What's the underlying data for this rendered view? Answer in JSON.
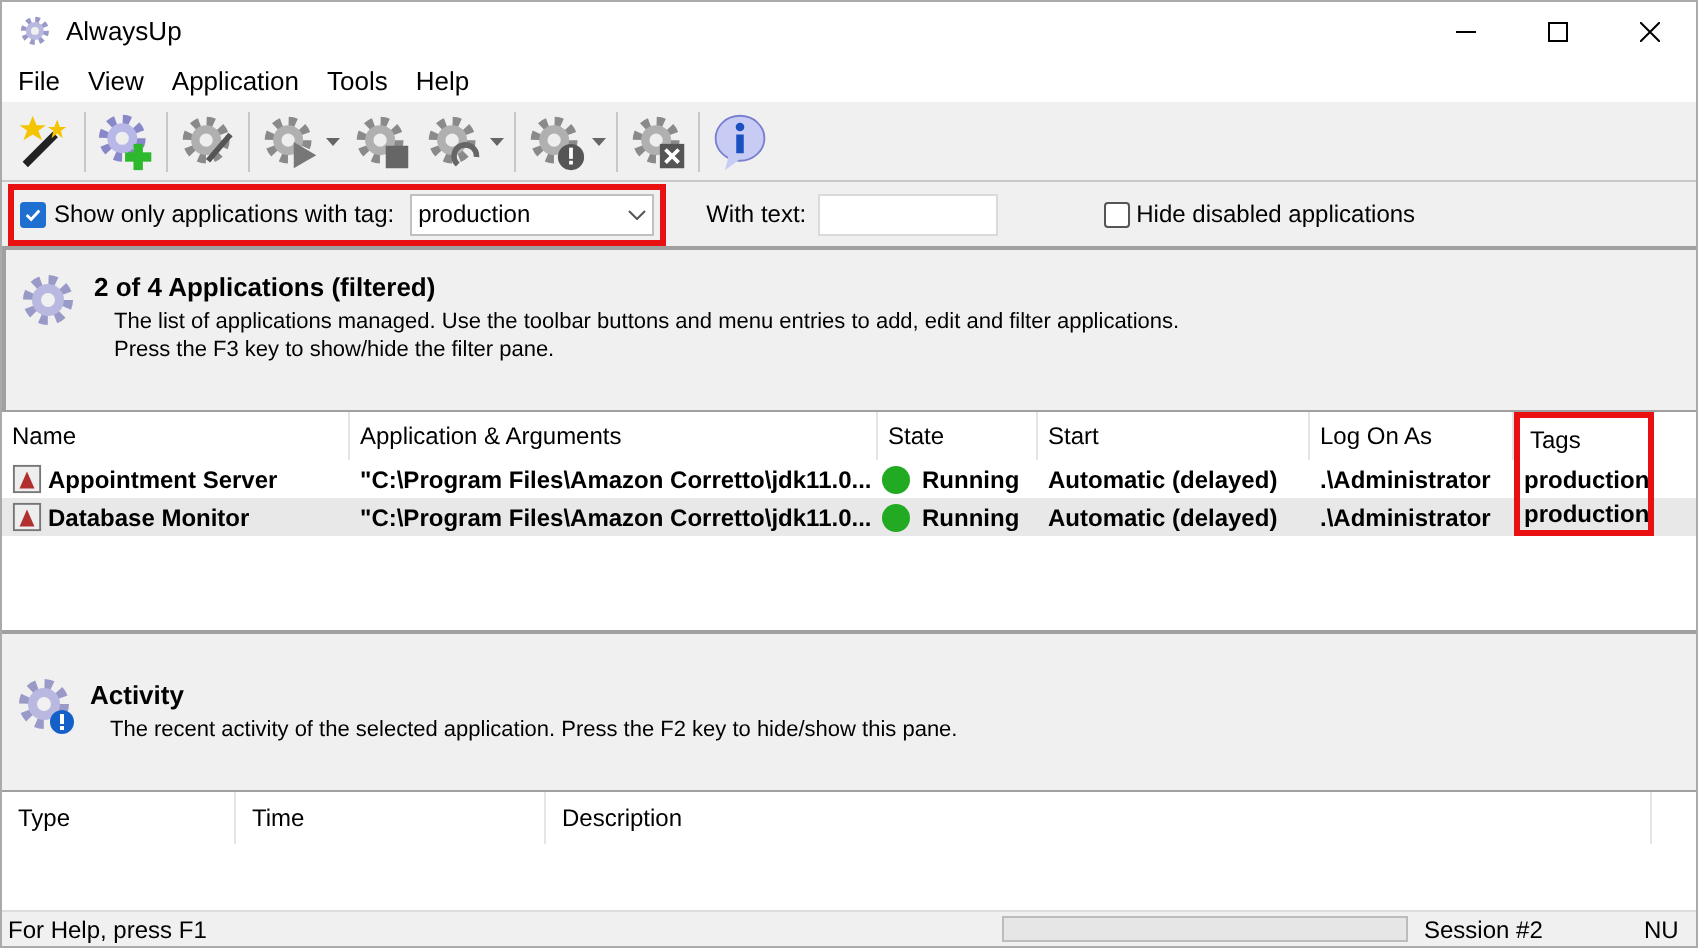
{
  "window": {
    "title": "AlwaysUp"
  },
  "menu": [
    "File",
    "View",
    "Application",
    "Tools",
    "Help"
  ],
  "toolbar": [
    {
      "kind": "wand",
      "dropdown": false
    },
    {
      "kind": "add",
      "dropdown": false
    },
    {
      "kind": "edit",
      "dropdown": false
    },
    {
      "kind": "start",
      "dropdown": true
    },
    {
      "kind": "stop",
      "dropdown": false
    },
    {
      "kind": "restart",
      "dropdown": true
    },
    {
      "kind": "alert",
      "dropdown": true
    },
    {
      "kind": "remove",
      "dropdown": false
    },
    {
      "kind": "info",
      "dropdown": false
    }
  ],
  "filter": {
    "tag_checkbox": {
      "label": "Show only applications with tag:",
      "checked": true
    },
    "tag_value": "production",
    "highlighted": true,
    "text_label": "With text:",
    "hide_disabled": {
      "label": "Hide disabled applications",
      "checked": false
    }
  },
  "apps_header": {
    "title": "2 of 4 Applications (filtered)",
    "lines": [
      "The list of applications managed. Use the toolbar buttons and menu entries to add, edit and filter applications.",
      "Press the F3 key to show/hide the filter pane."
    ]
  },
  "table": {
    "columns": [
      {
        "label": "Name",
        "highlighted": false
      },
      {
        "label": "Application & Arguments",
        "highlighted": false
      },
      {
        "label": "State",
        "highlighted": false
      },
      {
        "label": "Start",
        "highlighted": false
      },
      {
        "label": "Log On As",
        "highlighted": false
      },
      {
        "label": "Tags",
        "highlighted": true
      }
    ],
    "rows": [
      {
        "name": "Appointment Server",
        "app": "\"C:\\Program Files\\Amazon Corretto\\jdk11.0...",
        "state": "Running",
        "color": "#22aa22",
        "start": "Automatic (delayed)",
        "logon": ".\\Administrator",
        "tags": "production",
        "selected": false
      },
      {
        "name": "Database Monitor",
        "app": "\"C:\\Program Files\\Amazon Corretto\\jdk11.0...",
        "state": "Running",
        "color": "#22aa22",
        "start": "Automatic (delayed)",
        "logon": ".\\Administrator",
        "tags": "production",
        "selected": true
      }
    ]
  },
  "activity_header": {
    "title": "Activity",
    "line": "The recent activity of the selected application. Press the F2 key to hide/show this pane."
  },
  "activity_table": {
    "columns": [
      "Type",
      "Time",
      "Description"
    ]
  },
  "status_bar": {
    "help": "For Help, press F1",
    "session": "Session #2",
    "keys": "NU"
  }
}
